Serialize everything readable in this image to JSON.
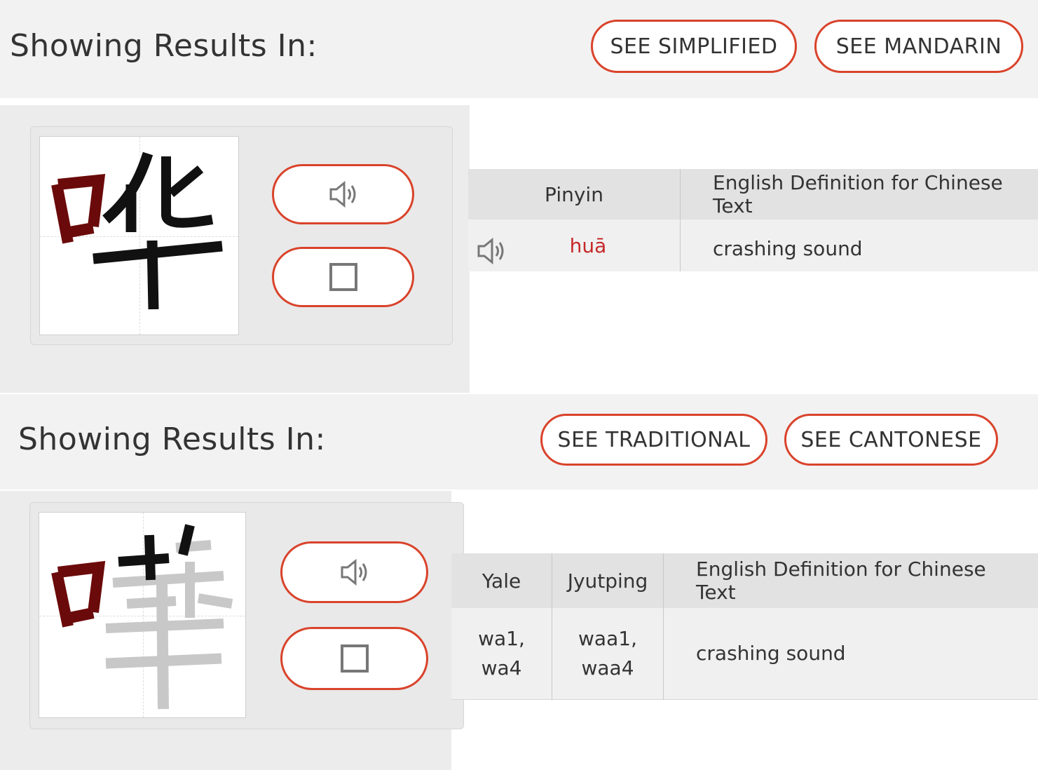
{
  "sections": [
    {
      "label": "Showing Results In:",
      "buttons": [
        "SEE SIMPLIFIED",
        "SEE MANDARIN"
      ],
      "glyph_char": "哗",
      "table": {
        "headers": [
          "Pinyin",
          "English Definition for Chinese Text"
        ],
        "row": {
          "pinyin": "huā",
          "definition": "crashing sound"
        }
      }
    },
    {
      "label": "Showing Results In:",
      "buttons": [
        "SEE TRADITIONAL",
        "SEE CANTONESE"
      ],
      "glyph_char": "嘩",
      "table": {
        "headers": [
          "Yale",
          "Jyutping",
          "English Definition for Chinese Text"
        ],
        "row": {
          "yale": "wa1,\nwa4",
          "jyutping": "waa1,\nwaa4",
          "definition": "crashing sound"
        }
      }
    }
  ],
  "colors": {
    "accent": "#d9432b",
    "pinyin": "#c62828",
    "radical": "#6b0a0a",
    "stroke_done": "#111111",
    "stroke_pending": "#c8c8c8"
  },
  "icons": {
    "play": "speaker-icon",
    "stop": "stop-square-icon"
  }
}
